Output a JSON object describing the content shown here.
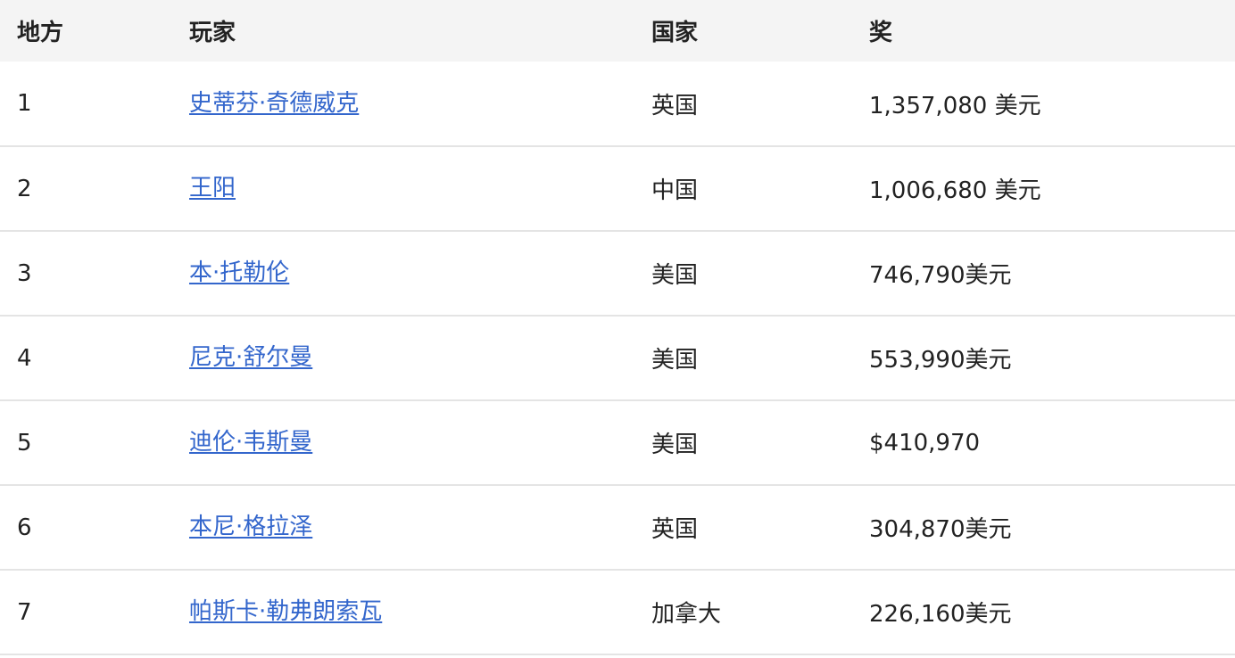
{
  "table": {
    "headers": {
      "place": "地方",
      "player": "玩家",
      "country": "国家",
      "prize": "奖"
    },
    "rows": [
      {
        "place": "1",
        "player": "史蒂芬·奇德威克",
        "country": "英国",
        "prize": "1,357,080 美元"
      },
      {
        "place": "2",
        "player": "王阳",
        "country": "中国",
        "prize": "1,006,680 美元"
      },
      {
        "place": "3",
        "player": "本·托勒伦",
        "country": "美国",
        "prize": "746,790美元"
      },
      {
        "place": "4",
        "player": "尼克·舒尔曼",
        "country": "美国",
        "prize": "553,990美元"
      },
      {
        "place": "5",
        "player": "迪伦·韦斯曼",
        "country": "美国",
        "prize": "$410,970"
      },
      {
        "place": "6",
        "player": "本尼·格拉泽",
        "country": "英国",
        "prize": "304,870美元"
      },
      {
        "place": "7",
        "player": "帕斯卡·勒弗朗索瓦",
        "country": "加拿大",
        "prize": "226,160美元"
      }
    ]
  }
}
